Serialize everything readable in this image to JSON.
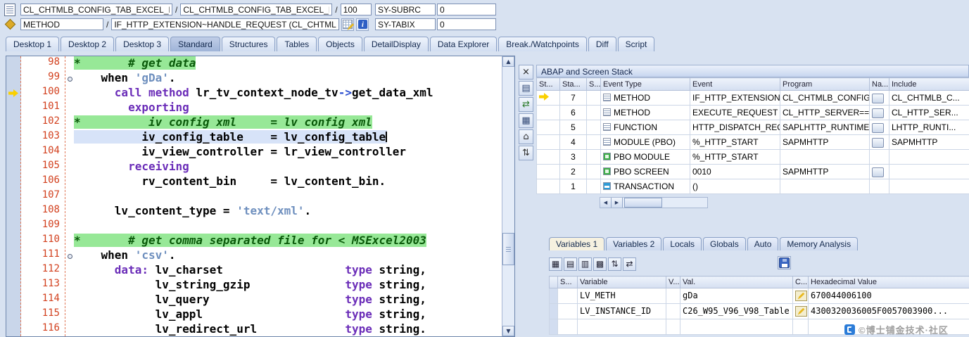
{
  "glyphs": {
    "up": "▲",
    "down": "▼",
    "left": "◀",
    "right": "▶",
    "info": "i"
  },
  "topbar": {
    "row1": {
      "field1": "CL_CHTMLB_CONFIG_TAB_EXCEL_EX..",
      "sep1": "/",
      "field2": "CL_CHTMLB_CONFIG_TAB_EXCEL_EX..",
      "sep2": "/",
      "field3": "100",
      "watch_name": "SY-SUBRC",
      "watch_value": "0"
    },
    "row2": {
      "field1": "METHOD",
      "sep1": "/",
      "field2": "IF_HTTP_EXTENSION~HANDLE_REQUEST (CL_CHTMLB..",
      "watch_name": "SY-TABIX",
      "watch_value": "0"
    }
  },
  "desktop_tabs": {
    "items": [
      "Desktop 1",
      "Desktop 2",
      "Desktop 3",
      "Standard",
      "Structures",
      "Tables",
      "Objects",
      "DetailDisplay",
      "Data Explorer",
      "Break./Watchpoints",
      "Diff",
      "Script"
    ],
    "active": "Standard"
  },
  "editor": {
    "lines": [
      {
        "n": "98",
        "hl": "comment",
        "marker": null,
        "cursor": false,
        "segs": [
          [
            "cm",
            "*       # get data"
          ]
        ]
      },
      {
        "n": "99",
        "hl": null,
        "marker": "dot",
        "cursor": false,
        "segs": [
          [
            "pl",
            "    "
          ],
          [
            "id",
            "when "
          ],
          [
            "st",
            "'gDa'"
          ],
          [
            "id",
            "."
          ]
        ]
      },
      {
        "n": "100",
        "hl": null,
        "marker": "arrow",
        "cursor": false,
        "segs": [
          [
            "pl",
            "      "
          ],
          [
            "kw",
            "call method"
          ],
          [
            "id",
            " lr_tv_context_node_tv"
          ],
          [
            "op",
            "->"
          ],
          [
            "id",
            "get_data_xml"
          ]
        ]
      },
      {
        "n": "101",
        "hl": null,
        "marker": null,
        "cursor": false,
        "segs": [
          [
            "pl",
            "        "
          ],
          [
            "kw",
            "exporting"
          ]
        ]
      },
      {
        "n": "102",
        "hl": "comment",
        "marker": null,
        "cursor": false,
        "segs": [
          [
            "cm",
            "*          iv config xml     = lv config xml"
          ]
        ]
      },
      {
        "n": "103",
        "hl": "cursor",
        "marker": null,
        "cursor": true,
        "segs": [
          [
            "pl",
            "          "
          ],
          [
            "id",
            "iv_config_table    = lv_config_table"
          ]
        ]
      },
      {
        "n": "104",
        "hl": null,
        "marker": null,
        "cursor": false,
        "segs": [
          [
            "pl",
            "          "
          ],
          [
            "id",
            "iv_view_controller = lr_view_controller"
          ]
        ]
      },
      {
        "n": "105",
        "hl": null,
        "marker": null,
        "cursor": false,
        "segs": [
          [
            "pl",
            "        "
          ],
          [
            "kw",
            "receiving"
          ]
        ]
      },
      {
        "n": "106",
        "hl": null,
        "marker": null,
        "cursor": false,
        "segs": [
          [
            "pl",
            "          "
          ],
          [
            "id",
            "rv_content_bin     = lv_content_bin."
          ]
        ]
      },
      {
        "n": "107",
        "hl": null,
        "marker": null,
        "cursor": false,
        "segs": []
      },
      {
        "n": "108",
        "hl": null,
        "marker": null,
        "cursor": false,
        "segs": [
          [
            "pl",
            "      "
          ],
          [
            "id",
            "lv_content_type = "
          ],
          [
            "st",
            "'text/xml'"
          ],
          [
            "id",
            "."
          ]
        ]
      },
      {
        "n": "109",
        "hl": null,
        "marker": null,
        "cursor": false,
        "segs": []
      },
      {
        "n": "110",
        "hl": "comment",
        "marker": null,
        "cursor": false,
        "segs": [
          [
            "cm",
            "*       # get comma separated file for < MSExcel2003"
          ]
        ]
      },
      {
        "n": "111",
        "hl": null,
        "marker": "dot",
        "cursor": false,
        "segs": [
          [
            "pl",
            "    "
          ],
          [
            "id",
            "when "
          ],
          [
            "st",
            "'csv'"
          ],
          [
            "id",
            "."
          ]
        ]
      },
      {
        "n": "112",
        "hl": null,
        "marker": null,
        "cursor": false,
        "segs": [
          [
            "pl",
            "      "
          ],
          [
            "kw",
            "data:"
          ],
          [
            "id",
            " lv_charset"
          ],
          [
            "pl",
            "                  "
          ],
          [
            "kw",
            "type"
          ],
          [
            "id",
            " string,"
          ]
        ]
      },
      {
        "n": "113",
        "hl": null,
        "marker": null,
        "cursor": false,
        "segs": [
          [
            "pl",
            "            "
          ],
          [
            "id",
            "lv_string_gzip"
          ],
          [
            "pl",
            "              "
          ],
          [
            "kw",
            "type"
          ],
          [
            "id",
            " string,"
          ]
        ]
      },
      {
        "n": "114",
        "hl": null,
        "marker": null,
        "cursor": false,
        "segs": [
          [
            "pl",
            "            "
          ],
          [
            "id",
            "lv_query"
          ],
          [
            "pl",
            "                    "
          ],
          [
            "kw",
            "type"
          ],
          [
            "id",
            " string,"
          ]
        ]
      },
      {
        "n": "115",
        "hl": null,
        "marker": null,
        "cursor": false,
        "segs": [
          [
            "pl",
            "            "
          ],
          [
            "id",
            "lv_appl"
          ],
          [
            "pl",
            "                     "
          ],
          [
            "kw",
            "type"
          ],
          [
            "id",
            " string,"
          ]
        ]
      },
      {
        "n": "116",
        "hl": null,
        "marker": null,
        "cursor": false,
        "segs": [
          [
            "pl",
            "            "
          ],
          [
            "id",
            "lv_redirect_url"
          ],
          [
            "pl",
            "             "
          ],
          [
            "kw",
            "type"
          ],
          [
            "id",
            " string."
          ]
        ]
      }
    ]
  },
  "editor_tools": [
    {
      "name": "close-editor-icon",
      "glyph": "×",
      "color": "#222"
    },
    {
      "name": "new-window-icon",
      "glyph": "▤",
      "color": "#334a77"
    },
    {
      "name": "swap-icon",
      "glyph": "⇄",
      "color": "#2a7a2a"
    },
    {
      "name": "display-grid-icon",
      "glyph": "▦",
      "color": "#334a77"
    },
    {
      "name": "home-icon",
      "glyph": "⌂",
      "color": "#333"
    },
    {
      "name": "services-icon",
      "glyph": "⇅",
      "color": "#333"
    }
  ],
  "stack": {
    "title": "ABAP and Screen Stack",
    "columns": [
      "St...",
      "Sta...",
      "S...",
      "Event Type",
      "Event",
      "Program",
      "Na...",
      "Include"
    ],
    "rows": [
      {
        "active": true,
        "level": "7",
        "ticon": "list",
        "type": "METHOD",
        "event": "IF_HTTP_EXTENSION~H...",
        "event_link": false,
        "program": "CL_CHTMLB_CONFIG_TA...",
        "program_link": true,
        "nav": true,
        "include": "CL_CHTMLB_C...",
        "include_link": true
      },
      {
        "active": false,
        "level": "6",
        "ticon": "list",
        "type": "METHOD",
        "event": "EXECUTE_REQUEST",
        "event_link": true,
        "program": "CL_HTTP_SERVER====...",
        "program_link": true,
        "nav": true,
        "include": "CL_HTTP_SER...",
        "include_link": true
      },
      {
        "active": false,
        "level": "5",
        "ticon": "list",
        "type": "FUNCTION",
        "event": "HTTP_DISPATCH_REQU...",
        "event_link": true,
        "program": "SAPLHTTP_RUNTIME",
        "program_link": true,
        "nav": true,
        "include": "LHTTP_RUNTI...",
        "include_link": true
      },
      {
        "active": false,
        "level": "4",
        "ticon": "list",
        "type": "MODULE (PBO)",
        "event": "%_HTTP_START",
        "event_link": false,
        "program": "SAPMHTTP",
        "program_link": false,
        "nav": true,
        "include": "SAPMHTTP",
        "include_link": false
      },
      {
        "active": false,
        "level": "3",
        "ticon": "green",
        "type": "PBO MODULE",
        "event": "%_HTTP_START",
        "event_link": false,
        "program": "",
        "program_link": false,
        "nav": false,
        "include": "",
        "include_link": false
      },
      {
        "active": false,
        "level": "2",
        "ticon": "green",
        "type": "PBO SCREEN",
        "event": "0010",
        "event_link": false,
        "program": "SAPMHTTP",
        "program_link": false,
        "nav": true,
        "include": "",
        "include_link": false
      },
      {
        "active": false,
        "level": "1",
        "ticon": "trans",
        "type": "TRANSACTION",
        "event": "()",
        "event_link": false,
        "program": "",
        "program_link": false,
        "nav": false,
        "include": "",
        "include_link": false
      }
    ]
  },
  "variables": {
    "tabs": [
      "Variables 1",
      "Variables 2",
      "Locals",
      "Globals",
      "Auto",
      "Memory Analysis"
    ],
    "active_tab": "Variables 1",
    "toolbar": [
      {
        "name": "table-create-icon",
        "glyph": "▦"
      },
      {
        "name": "table-delete-icon",
        "glyph": "▤"
      },
      {
        "name": "table-change-icon",
        "glyph": "▥"
      },
      {
        "name": "column-layout-icon",
        "glyph": "▩"
      },
      {
        "name": "sort-icon",
        "glyph": "⇅"
      },
      {
        "name": "compare-icon",
        "glyph": "⇄"
      }
    ],
    "save_icon": "save-icon",
    "columns": [
      "S...",
      "Variable",
      "V...",
      "Val.",
      "C...",
      "Hexadecimal Value"
    ],
    "rows": [
      {
        "variable": "LV_METH",
        "val": "gDa",
        "hex": "670044006100"
      },
      {
        "variable": "LV_INSTANCE_ID",
        "val": "C26_W95_V96_V98_Table",
        "hex": "4300320036005F0057003900..."
      }
    ]
  },
  "watermark": {
    "text": "©博士铺金技术·社区"
  }
}
